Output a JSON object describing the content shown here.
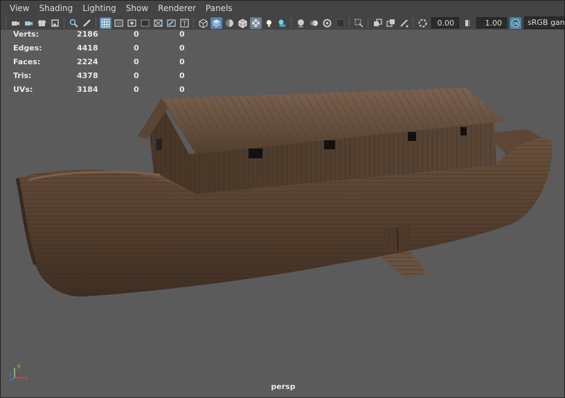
{
  "menu": {
    "items": [
      "View",
      "Shading",
      "Lighting",
      "Show",
      "Renderer",
      "Panels"
    ]
  },
  "toolbar": {
    "icons": [
      "select-camera-icon",
      "camera-attributes-icon",
      "bookmarks-icon",
      "image-plane-icon",
      "2d-pan-zoom-icon",
      "grease-pencil-icon",
      "grid-icon",
      "film-gate-icon",
      "resolution-gate-icon",
      "gate-mask-icon",
      "field-chart-icon",
      "safe-action-icon",
      "safe-title-icon",
      "wireframe-icon",
      "smooth-shade-icon",
      "default-material-icon",
      "wireframe-on-shaded-icon",
      "xray-icon",
      "use-all-lights-icon",
      "shadows-icon",
      "screen-space-ao-icon",
      "motion-blur-icon",
      "multisample-aa-icon",
      "depth-of-field-icon",
      "isolate-select-icon",
      "xray-active-components-icon",
      "xray-joints-icon",
      "backface-culling-icon",
      "exposure-icon",
      "gamma-icon",
      "color-management-icon"
    ],
    "exposure_value": "0.00",
    "gamma_value": "1.00",
    "color_space": "sRGB gamma",
    "accent_color": "#5285a6"
  },
  "hud": {
    "rows": [
      {
        "label": "Verts:",
        "v1": "2186",
        "v2": "0",
        "v3": "0"
      },
      {
        "label": "Edges:",
        "v1": "4418",
        "v2": "0",
        "v3": "0"
      },
      {
        "label": "Faces:",
        "v1": "2224",
        "v2": "0",
        "v3": "0"
      },
      {
        "label": "Tris:",
        "v1": "4378",
        "v2": "0",
        "v3": "0"
      },
      {
        "label": "UVs:",
        "v1": "3184",
        "v2": "0",
        "v3": "0"
      }
    ]
  },
  "viewport": {
    "camera": "persp",
    "background_color": "#5b5b5b",
    "axis_labels": {
      "x": "x",
      "y": "y",
      "z": "z"
    }
  }
}
